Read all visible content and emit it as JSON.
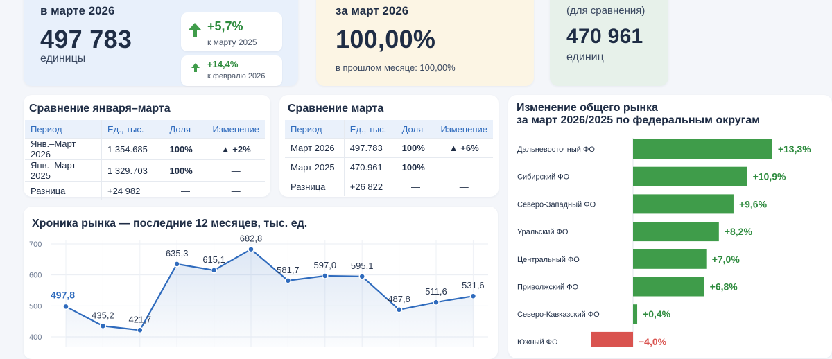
{
  "kpi": {
    "current": {
      "label": "в марте 2026",
      "value": "497 783",
      "unit": "единицы",
      "delta1": {
        "value": "+5,7%",
        "caption": "к марту 2025"
      },
      "delta2": {
        "value": "+14,4%",
        "caption": "к февралю 2026"
      }
    },
    "share": {
      "label": "за март 2026",
      "value": "100,00%",
      "sub": "в прошлом месяце: 100,00%"
    },
    "compare": {
      "label": "(для сравнения)",
      "value": "470 961",
      "unit": "единиц"
    }
  },
  "table_q1": {
    "title": "Сравнение января–марта",
    "headers": [
      "Период",
      "Ед., тыс.",
      "Доля",
      "Изменение"
    ],
    "rows": [
      [
        "Янв.–Март 2026",
        "1 354.685",
        "100%",
        "+2%"
      ],
      [
        "Янв.–Март 2025",
        "1 329.703",
        "100%",
        "—"
      ],
      [
        "Разница",
        "+24 982",
        "—",
        "—"
      ]
    ]
  },
  "table_march": {
    "title": "Сравнение марта",
    "headers": [
      "Период",
      "Ед., тыс.",
      "Доля",
      "Изменение"
    ],
    "rows": [
      [
        "Март 2026",
        "497.783",
        "100%",
        "+6%"
      ],
      [
        "Март 2025",
        "470.961",
        "100%",
        "—"
      ],
      [
        "Разница",
        "+26 822",
        "—",
        "—"
      ]
    ]
  },
  "line_chart": {
    "title": "Хроника рынка — последние 12 месяцев, тыс. ед.",
    "yticks": [
      "700",
      "600",
      "500",
      "400"
    ]
  },
  "bars_chart": {
    "title_line1": "Изменение общего рынка",
    "title_line2": "за март 2026/2025 по федеральным округам"
  },
  "colors": {
    "accent": "#2f6bbd",
    "positive": "#3f9c4a",
    "negative": "#d9534f"
  },
  "chart_data": [
    {
      "type": "line",
      "title": "Хроника рынка — последние 12 месяцев, тыс. ед.",
      "ylim": [
        400,
        700
      ],
      "grid": true,
      "values": [
        497.8,
        435.2,
        421.7,
        635.3,
        615.1,
        682.8,
        581.7,
        597.0,
        595.1,
        487.8,
        511.6,
        531.6
      ],
      "labels": [
        "497,8",
        "435,2",
        "421,7",
        "635,3",
        "615,1",
        "682,8",
        "581,7",
        "597,0",
        "595,1",
        "487,8",
        "511,6",
        "531,6"
      ]
    },
    {
      "type": "bar",
      "orientation": "horizontal",
      "title": "Изменение общего рынка за март 2026/2025 по федеральным округам",
      "categories": [
        "Дальневосточный ФО",
        "Сибирский ФО",
        "Северо-Западный ФО",
        "Уральский ФО",
        "Центральный ФО",
        "Приволжский ФО",
        "Северо-Кавказский ФО",
        "Южный ФО"
      ],
      "values": [
        13.3,
        10.9,
        9.6,
        8.2,
        7.0,
        6.8,
        0.4,
        -4.0
      ],
      "labels": [
        "+13,3%",
        "+10,9%",
        "+9,6%",
        "+8,2%",
        "+7,0%",
        "+6,8%",
        "+0,4%",
        "−4,0%"
      ]
    }
  ]
}
